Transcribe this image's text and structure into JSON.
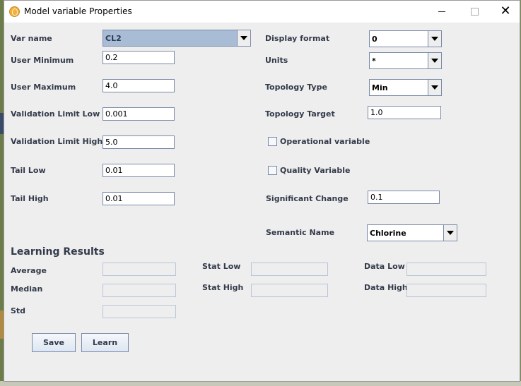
{
  "window": {
    "title": "Model variable Properties",
    "controls": {
      "minimize": "—",
      "maximize": "☐",
      "close": "✕"
    }
  },
  "left_fields": [
    {
      "label": "Var name",
      "value": "CL2",
      "kind": "combo"
    },
    {
      "label": "User Minimum",
      "value": "0.2"
    },
    {
      "label": "User Maximum",
      "value": "4.0"
    },
    {
      "label": "Validation Limit Low",
      "value": "0.001"
    },
    {
      "label": "Validation Limit High",
      "value": "5.0"
    },
    {
      "label": "Tail Low",
      "value": "0.01"
    },
    {
      "label": "Tail High",
      "value": "0.01"
    }
  ],
  "right_fields": {
    "display_format": {
      "label": "Display format",
      "value": "0"
    },
    "units": {
      "label": "Units",
      "value": "*"
    },
    "topology_type": {
      "label": "Topology Type",
      "value": "Min"
    },
    "topology_target": {
      "label": "Topology Target",
      "value": "1.0"
    },
    "operational_variable": {
      "label": "Operational variable",
      "checked": false
    },
    "quality_variable": {
      "label": "Quality Variable",
      "checked": false
    },
    "significant_change": {
      "label": "Significant Change",
      "value": "0.1"
    },
    "semantic_name": {
      "label": "Semantic Name",
      "value": "Chlorine"
    }
  },
  "learning_results": {
    "title": "Learning Results",
    "average": {
      "label": "Average",
      "value": ""
    },
    "median": {
      "label": "Median",
      "value": ""
    },
    "std": {
      "label": "Std",
      "value": ""
    },
    "stat_low": {
      "label": "Stat Low",
      "value": ""
    },
    "stat_high": {
      "label": "Stat High",
      "value": ""
    },
    "data_low": {
      "label": "Data Low",
      "value": ""
    },
    "data_high": {
      "label": "Data High",
      "value": ""
    }
  },
  "buttons": {
    "save": "Save",
    "learn": "Learn"
  },
  "colors": {
    "dialog_bg": "#eeeeee",
    "label_text": "#333a4a",
    "field_border": "#7a8aa8",
    "selected_combo": "#a8bcd6"
  }
}
